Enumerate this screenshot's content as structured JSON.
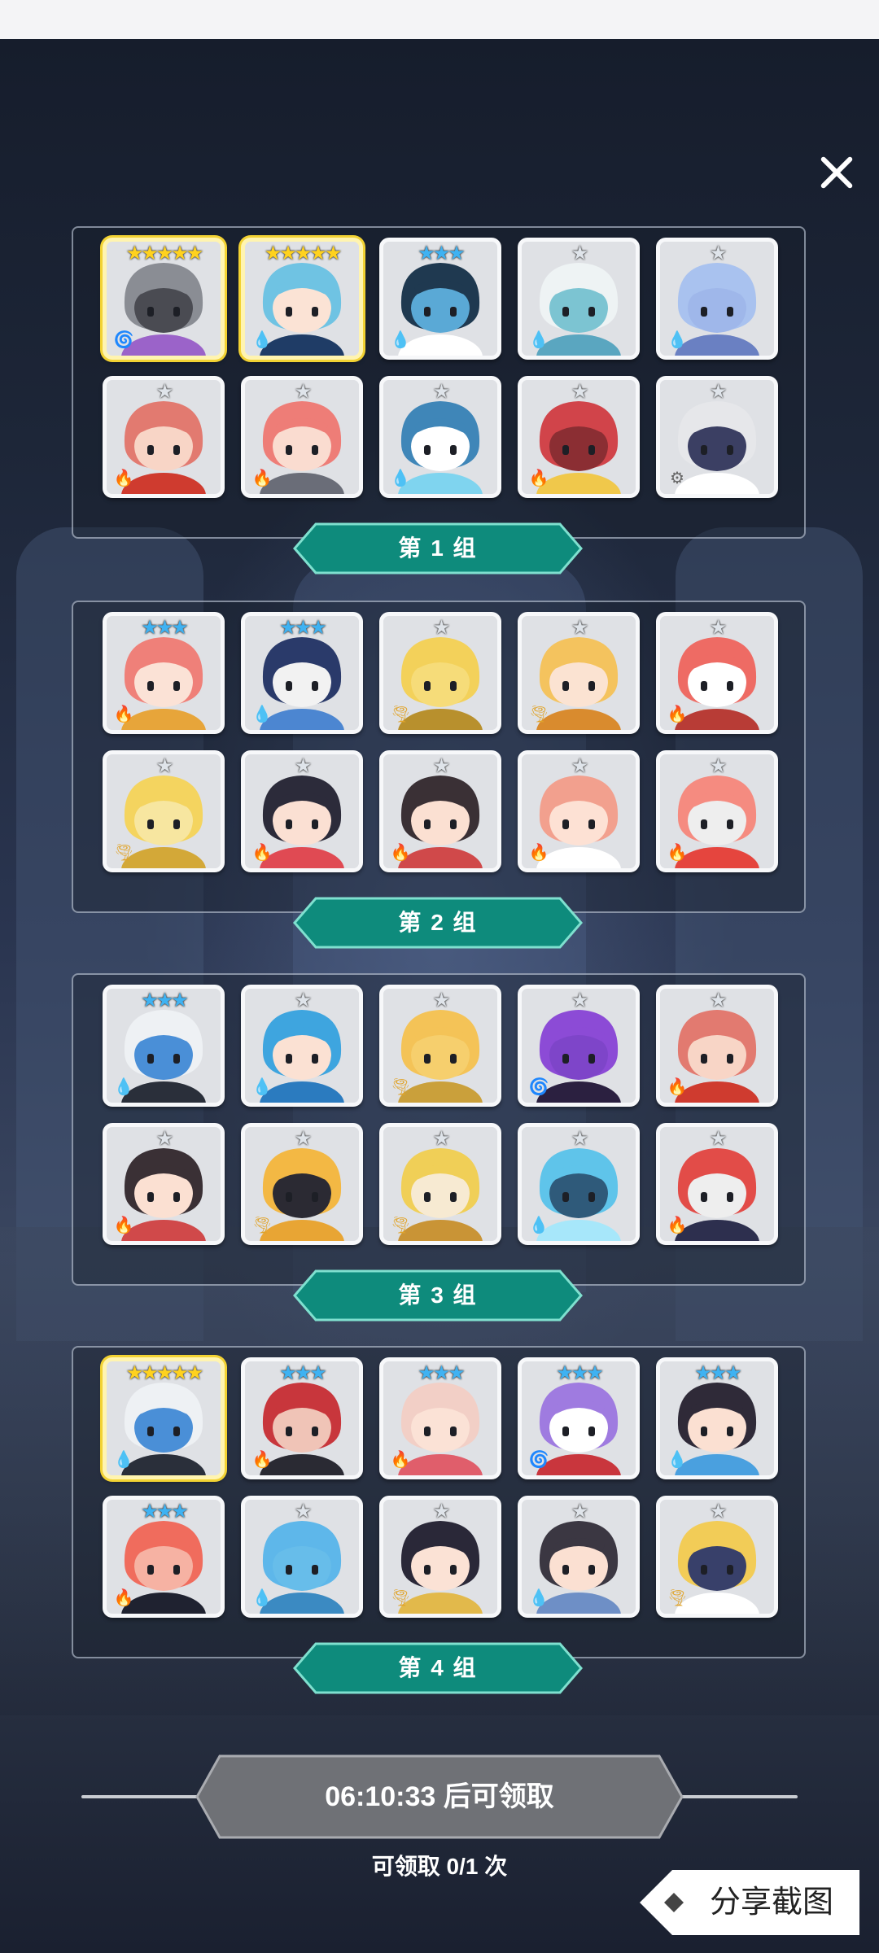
{
  "groups": [
    {
      "label": "第 1 组",
      "cards": [
        {
          "stars": "★★★★★",
          "tier": "gold",
          "element": "dark",
          "gold": true,
          "hero": "dark-knight"
        },
        {
          "stars": "★★★★★",
          "tier": "gold",
          "element": "water",
          "gold": true,
          "hero": "blue-hair-mage"
        },
        {
          "stars": "★★★",
          "tier": "blue",
          "element": "water",
          "gold": false,
          "hero": "one-eye-tree"
        },
        {
          "stars": "★",
          "tier": "silver",
          "element": "water",
          "gold": false,
          "hero": "bandaged-frog"
        },
        {
          "stars": "★",
          "tier": "silver",
          "element": "water",
          "gold": false,
          "hero": "blue-ghost"
        },
        {
          "stars": "★",
          "tier": "silver",
          "element": "fire",
          "gold": false,
          "hero": "red-soldier"
        },
        {
          "stars": "★",
          "tier": "silver",
          "element": "fire",
          "gold": false,
          "hero": "red-hair-girl"
        },
        {
          "stars": "★",
          "tier": "silver",
          "element": "water",
          "gold": false,
          "hero": "water-spirit"
        },
        {
          "stars": "★",
          "tier": "silver",
          "element": "fire",
          "gold": false,
          "hero": "red-chest"
        },
        {
          "stars": "★",
          "tier": "silver",
          "element": "light",
          "gold": false,
          "hero": "white-knight"
        }
      ]
    },
    {
      "label": "第 2 组",
      "cards": [
        {
          "stars": "★★★",
          "tier": "blue",
          "element": "fire",
          "gold": false,
          "hero": "queen"
        },
        {
          "stars": "★★★",
          "tier": "blue",
          "element": "water",
          "gold": false,
          "hero": "wolf-sage"
        },
        {
          "stars": "★",
          "tier": "silver",
          "element": "wind",
          "gold": false,
          "hero": "lion"
        },
        {
          "stars": "★",
          "tier": "silver",
          "element": "wind",
          "gold": false,
          "hero": "blonde-girl"
        },
        {
          "stars": "★",
          "tier": "silver",
          "element": "fire",
          "gold": false,
          "hero": "fox-warrior"
        },
        {
          "stars": "★",
          "tier": "silver",
          "element": "wind",
          "gold": false,
          "hero": "golden-beast"
        },
        {
          "stars": "★",
          "tier": "silver",
          "element": "fire",
          "gold": false,
          "hero": "shrine-maiden"
        },
        {
          "stars": "★",
          "tier": "silver",
          "element": "fire",
          "gold": false,
          "hero": "helmet-boy"
        },
        {
          "stars": "★",
          "tier": "silver",
          "element": "fire",
          "gold": false,
          "hero": "flower-girl"
        },
        {
          "stars": "★",
          "tier": "silver",
          "element": "fire",
          "gold": false,
          "hero": "phoenix-knight"
        }
      ]
    },
    {
      "label": "第 3 组",
      "cards": [
        {
          "stars": "★★★",
          "tier": "blue",
          "element": "water",
          "gold": false,
          "hero": "mummy-shark"
        },
        {
          "stars": "★",
          "tier": "silver",
          "element": "water",
          "gold": false,
          "hero": "blue-bow-girl"
        },
        {
          "stars": "★",
          "tier": "silver",
          "element": "wind",
          "gold": false,
          "hero": "cactus"
        },
        {
          "stars": "★",
          "tier": "silver",
          "element": "dark",
          "gold": false,
          "hero": "purple-skull"
        },
        {
          "stars": "★",
          "tier": "silver",
          "element": "fire",
          "gold": false,
          "hero": "red-soldier"
        },
        {
          "stars": "★",
          "tier": "silver",
          "element": "fire",
          "gold": false,
          "hero": "helmet-boy"
        },
        {
          "stars": "★",
          "tier": "silver",
          "element": "wind",
          "gold": false,
          "hero": "pharaoh"
        },
        {
          "stars": "★",
          "tier": "silver",
          "element": "wind",
          "gold": false,
          "hero": "sun-lion"
        },
        {
          "stars": "★",
          "tier": "silver",
          "element": "water",
          "gold": false,
          "hero": "ice-chest"
        },
        {
          "stars": "★",
          "tier": "silver",
          "element": "fire",
          "gold": false,
          "hero": "red-robot"
        }
      ]
    },
    {
      "label": "第 4 组",
      "cards": [
        {
          "stars": "★★★★★",
          "tier": "gold",
          "element": "water",
          "gold": true,
          "hero": "mummy-shark"
        },
        {
          "stars": "★★★",
          "tier": "blue",
          "element": "fire",
          "gold": false,
          "hero": "red-demon"
        },
        {
          "stars": "★★★",
          "tier": "blue",
          "element": "fire",
          "gold": false,
          "hero": "mushroom-girl"
        },
        {
          "stars": "★★★",
          "tier": "blue",
          "element": "dark",
          "gold": false,
          "hero": "mask-jester"
        },
        {
          "stars": "★★★",
          "tier": "blue",
          "element": "water",
          "gold": false,
          "hero": "ponytail-hero"
        },
        {
          "stars": "★★★",
          "tier": "blue",
          "element": "fire",
          "gold": false,
          "hero": "fire-flower"
        },
        {
          "stars": "★",
          "tier": "silver",
          "element": "water",
          "gold": false,
          "hero": "blue-cactus"
        },
        {
          "stars": "★",
          "tier": "silver",
          "element": "wind",
          "gold": false,
          "hero": "dark-maiden"
        },
        {
          "stars": "★",
          "tier": "silver",
          "element": "water",
          "gold": false,
          "hero": "blue-knight"
        },
        {
          "stars": "★",
          "tier": "silver",
          "element": "wind",
          "gold": false,
          "hero": "gold-knight"
        }
      ]
    }
  ],
  "timer": "06:10:33 后可领取",
  "claim_text": "可领取 0/1 次",
  "share_label": "分享截图",
  "colors": {
    "label_teal": "#0e8b7c",
    "label_border": "#7fe0cf",
    "star_gold": "#ffd21e",
    "star_blue": "#3fb2f2",
    "star_silver": "#dfe4ea"
  },
  "heroes": {
    "dark-knight": {
      "hair": "#8a8d94",
      "skin": "#4a4b52",
      "acc": "#9b63c9"
    },
    "blue-hair-mage": {
      "hair": "#6fc3e3",
      "skin": "#fbe3d5",
      "acc": "#1f3c66"
    },
    "one-eye-tree": {
      "hair": "#1f3950",
      "skin": "#5aa9d6",
      "acc": "#ffffff"
    },
    "bandaged-frog": {
      "hair": "#eef3f4",
      "skin": "#7cc4d2",
      "acc": "#5aa6c0"
    },
    "blue-ghost": {
      "hair": "#a9c2ef",
      "skin": "#9fb7ea",
      "acc": "#6a80c2"
    },
    "red-soldier": {
      "hair": "#e27a70",
      "skin": "#f8d5c6",
      "acc": "#cf3b2f"
    },
    "red-hair-girl": {
      "hair": "#ee7d77",
      "skin": "#fadcd0",
      "acc": "#6a6d78"
    },
    "water-spirit": {
      "hair": "#3f86b8",
      "skin": "#ffffff",
      "acc": "#7fd4ef"
    },
    "red-chest": {
      "hair": "#d1444a",
      "skin": "#8b2e33",
      "acc": "#f0c84b"
    },
    "white-knight": {
      "hair": "#e6e7ea",
      "skin": "#3b3f63",
      "acc": "#ffffff"
    },
    "queen": {
      "hair": "#ef8079",
      "skin": "#fbe2d6",
      "acc": "#e7a53a"
    },
    "wolf-sage": {
      "hair": "#2a3a6a",
      "skin": "#f2f2f2",
      "acc": "#4c86d1"
    },
    "lion": {
      "hair": "#f3d15a",
      "skin": "#f6dc79",
      "acc": "#b8902d"
    },
    "blonde-girl": {
      "hair": "#f4c35e",
      "skin": "#fbe3d2",
      "acc": "#d98b2e"
    },
    "fox-warrior": {
      "hair": "#ee6b64",
      "skin": "#ffffff",
      "acc": "#b83c36"
    },
    "golden-beast": {
      "hair": "#f4d45f",
      "skin": "#f7e6a0",
      "acc": "#d3a838"
    },
    "shrine-maiden": {
      "hair": "#2c2b3a",
      "skin": "#fbe0d3",
      "acc": "#e04a53"
    },
    "helmet-boy": {
      "hair": "#3a3035",
      "skin": "#fbe0d2",
      "acc": "#d0494a"
    },
    "flower-girl": {
      "hair": "#f2a08e",
      "skin": "#fde1d4",
      "acc": "#ffffff"
    },
    "phoenix-knight": {
      "hair": "#f58b80",
      "skin": "#eeeeee",
      "acc": "#e5453e"
    },
    "mummy-shark": {
      "hair": "#eef1f4",
      "skin": "#4a8fd7",
      "acc": "#2a2f3a"
    },
    "blue-bow-girl": {
      "hair": "#3ea5df",
      "skin": "#fbe1d3",
      "acc": "#2b7bbf"
    },
    "cactus": {
      "hair": "#f4c357",
      "skin": "#f6cf6d",
      "acc": "#caa03b"
    },
    "purple-skull": {
      "hair": "#8c4bd6",
      "skin": "#7e45c9",
      "acc": "#2b2040"
    },
    "pharaoh": {
      "hair": "#f3b844",
      "skin": "#2b2a33",
      "acc": "#e8a534"
    },
    "sun-lion": {
      "hair": "#f0cf57",
      "skin": "#f7ead2",
      "acc": "#c99436"
    },
    "ice-chest": {
      "hair": "#5fc4ea",
      "skin": "#2f5a7a",
      "acc": "#a7e7fa"
    },
    "red-robot": {
      "hair": "#e24c48",
      "skin": "#eeeeee",
      "acc": "#2d2f4e"
    },
    "red-demon": {
      "hair": "#c8363c",
      "skin": "#f0c4b7",
      "acc": "#2a2a33"
    },
    "mushroom-girl": {
      "hair": "#f2cfc6",
      "skin": "#fbe2d6",
      "acc": "#e05e6b"
    },
    "mask-jester": {
      "hair": "#9f7be0",
      "skin": "#ffffff",
      "acc": "#c9363d"
    },
    "ponytail-hero": {
      "hair": "#2f2a38",
      "skin": "#fbe0d2",
      "acc": "#4aa0df"
    },
    "fire-flower": {
      "hair": "#f06c5d",
      "skin": "#f6b2a3",
      "acc": "#1f2230"
    },
    "blue-cactus": {
      "hair": "#5eb7ea",
      "skin": "#67bdea",
      "acc": "#3b8ac2"
    },
    "dark-maiden": {
      "hair": "#2a2838",
      "skin": "#fbe2d5",
      "acc": "#e2b94b"
    },
    "blue-knight": {
      "hair": "#3b3742",
      "skin": "#fbe0d2",
      "acc": "#6e8fc6"
    },
    "gold-knight": {
      "hair": "#f2cc57",
      "skin": "#38406a",
      "acc": "#ffffff"
    }
  }
}
